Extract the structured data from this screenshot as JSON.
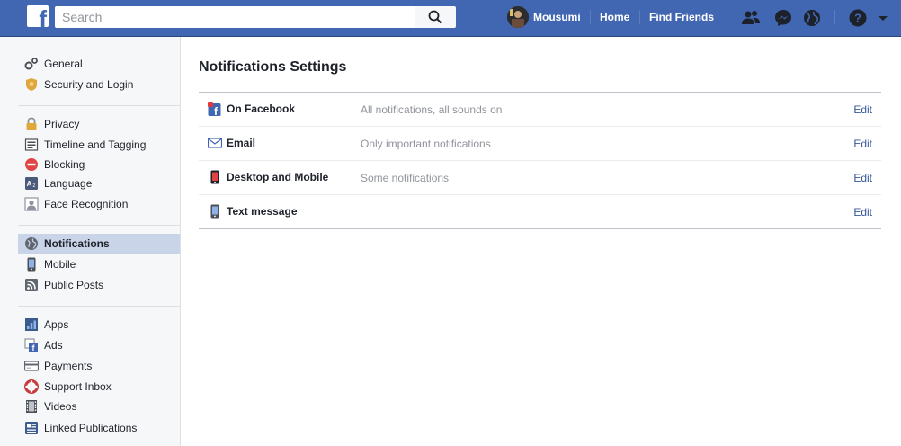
{
  "topbar": {
    "logo": "f",
    "search_placeholder": "Search",
    "user_name": "Mousumi",
    "home_label": "Home",
    "find_friends_label": "Find Friends",
    "icons": [
      "friend-requests-icon",
      "messenger-icon",
      "notifications-globe-icon",
      "help-icon",
      "caret-down-icon"
    ],
    "bar_color": "#4267b2"
  },
  "sidebar": {
    "groups": [
      [
        {
          "label": "General",
          "icon": "gears-icon"
        },
        {
          "label": "Security and Login",
          "icon": "shield-badge-icon"
        }
      ],
      [
        {
          "label": "Privacy",
          "icon": "lock-icon"
        },
        {
          "label": "Timeline and Tagging",
          "icon": "timeline-icon"
        },
        {
          "label": "Blocking",
          "icon": "blocking-icon"
        },
        {
          "label": "Language",
          "icon": "language-icon"
        },
        {
          "label": "Face Recognition",
          "icon": "face-recognition-icon"
        }
      ],
      [
        {
          "label": "Notifications",
          "icon": "globe-icon",
          "active": true
        },
        {
          "label": "Mobile",
          "icon": "mobile-icon"
        },
        {
          "label": "Public Posts",
          "icon": "rss-icon"
        }
      ],
      [
        {
          "label": "Apps",
          "icon": "apps-icon"
        },
        {
          "label": "Ads",
          "icon": "ads-icon"
        },
        {
          "label": "Payments",
          "icon": "payment-card-icon"
        },
        {
          "label": "Support Inbox",
          "icon": "lifebuoy-icon"
        },
        {
          "label": "Videos",
          "icon": "film-icon"
        },
        {
          "label": "Linked Publications",
          "icon": "publications-icon"
        }
      ]
    ]
  },
  "main": {
    "title": "Notifications Settings",
    "rows": [
      {
        "label": "On Facebook",
        "value": "All notifications, all sounds on",
        "edit": "Edit",
        "icon": "facebook-badge-icon"
      },
      {
        "label": "Email",
        "value": "Only important notifications",
        "edit": "Edit",
        "icon": "envelope-icon"
      },
      {
        "label": "Desktop and Mobile",
        "value": "Some notifications",
        "edit": "Edit",
        "icon": "phone-icon"
      },
      {
        "label": "Text message",
        "value": "",
        "edit": "Edit",
        "icon": "mobile-icon"
      }
    ]
  },
  "colors": {
    "brand": "#4267b2",
    "link": "#365899",
    "muted": "#90949c",
    "active_bg": "#c9d4e8"
  }
}
